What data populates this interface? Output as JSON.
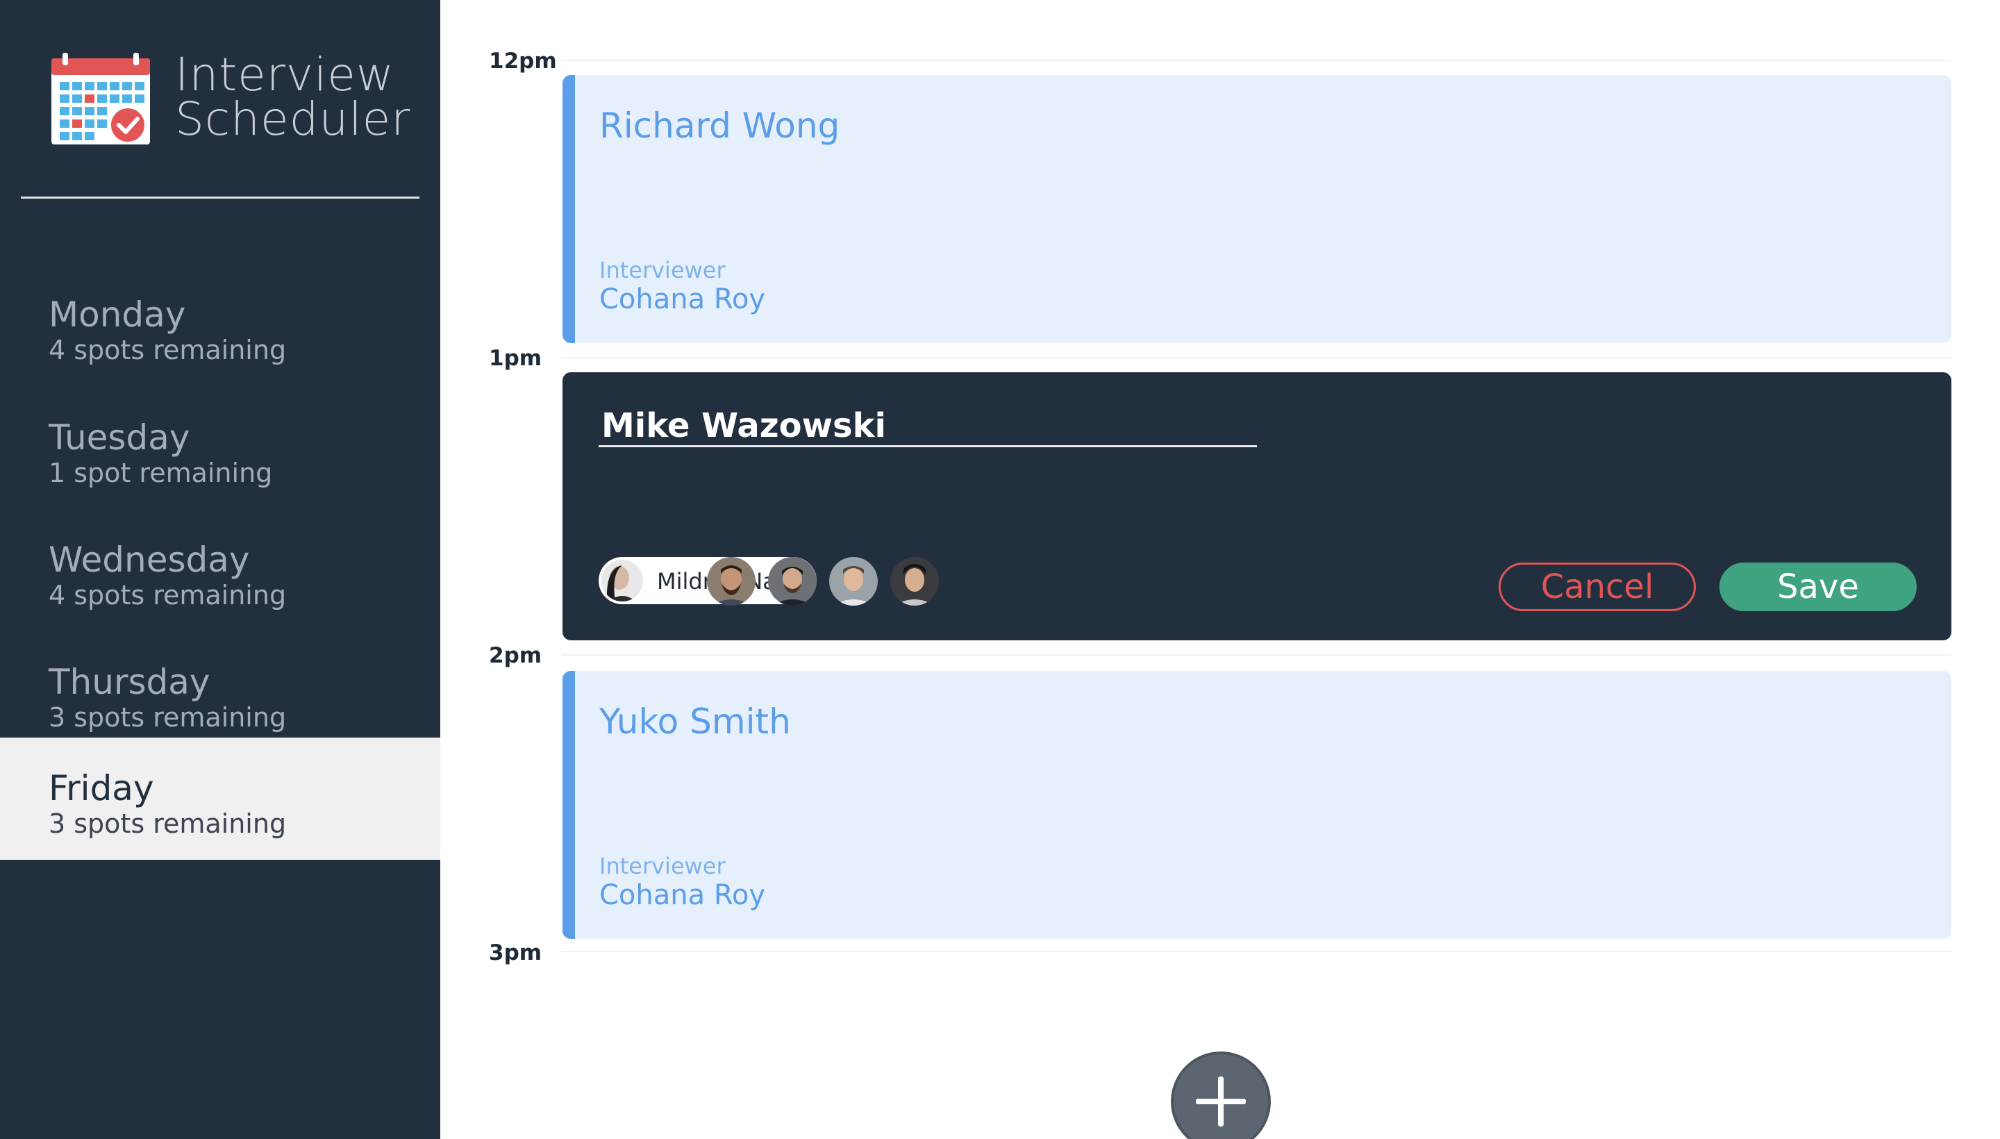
{
  "app": {
    "title_line1": "Interview",
    "title_line2": "Scheduler"
  },
  "sidebar": {
    "days": [
      {
        "name": "Monday",
        "spots": "4 spots remaining",
        "selected": false
      },
      {
        "name": "Tuesday",
        "spots": "1 spot remaining",
        "selected": false
      },
      {
        "name": "Wednesday",
        "spots": "4 spots remaining",
        "selected": false
      },
      {
        "name": "Thursday",
        "spots": "3 spots remaining",
        "selected": false
      },
      {
        "name": "Friday",
        "spots": "3 spots remaining",
        "selected": true
      }
    ]
  },
  "schedule": {
    "times": [
      "12pm",
      "1pm",
      "2pm",
      "3pm"
    ],
    "appointments": [
      {
        "student": "Richard Wong",
        "interviewer_label": "Interviewer",
        "interviewer": "Cohana Roy"
      },
      {
        "student": "Yuko Smith",
        "interviewer_label": "Interviewer",
        "interviewer": "Cohana Roy"
      }
    ],
    "editor": {
      "student_value": "Mike Wazowski",
      "selected_interviewer": "Mildred Nazir",
      "other_interviewer_count": 4,
      "cancel_label": "Cancel",
      "save_label": "Save"
    }
  },
  "colors": {
    "sidebar_bg": "#222f3e",
    "accent_blue": "#5b9de9",
    "appointment_bg": "#e6f0fd",
    "cancel_red": "#e25555",
    "save_green": "#3fa382"
  },
  "icons": {
    "logo": "calendar-check-icon",
    "add": "plus-icon"
  }
}
